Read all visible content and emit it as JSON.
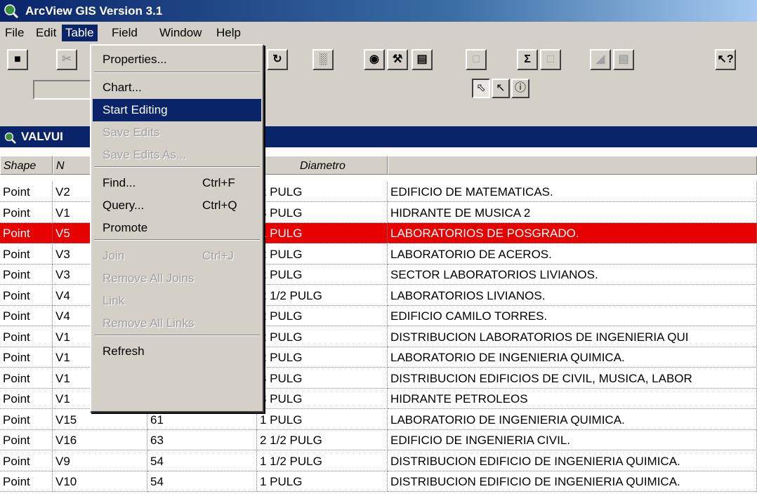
{
  "window": {
    "title": "ArcView GIS Version 3.1"
  },
  "menubar": {
    "items": [
      "File",
      "Edit",
      "Table",
      "Field",
      "Window",
      "Help"
    ]
  },
  "doc": {
    "title": "VALVUI"
  },
  "table": {
    "columns": [
      "Shape",
      "N",
      "",
      "Diametro",
      ""
    ],
    "rows": [
      [
        "Point",
        "V2",
        "",
        "2 PULG",
        "EDIFICIO DE MATEMATICAS."
      ],
      [
        "Point",
        "V1",
        "",
        "3 PULG",
        "HIDRANTE DE MUSICA 2"
      ],
      [
        "Point",
        "V5",
        "",
        "1 PULG",
        "LABORATORIOS DE POSGRADO."
      ],
      [
        "Point",
        "V3",
        "",
        "2 PULG",
        "LABORATORIO DE ACEROS."
      ],
      [
        "Point",
        "V3",
        "",
        "2 PULG",
        "SECTOR LABORATORIOS LIVIANOS."
      ],
      [
        "Point",
        "V4",
        "",
        "2 1/2 PULG",
        "LABORATORIOS LIVIANOS."
      ],
      [
        "Point",
        "V4",
        "",
        "2 PULG",
        "EDIFICIO CAMILO TORRES."
      ],
      [
        "Point",
        "V1",
        "",
        "2 PULG",
        "DISTRIBUCION LABORATORIOS DE INGENIERIA QUI"
      ],
      [
        "Point",
        "V1",
        "",
        "2 PULG",
        "LABORATORIO DE INGENIERIA QUIMICA."
      ],
      [
        "Point",
        "V1",
        "",
        "3 PULG",
        "DISTRIBUCION EDIFICIOS DE CIVIL, MUSICA, LABOR"
      ],
      [
        "Point",
        "V1",
        "",
        "3 PULG",
        "HIDRANTE PETROLEOS"
      ],
      [
        "Point",
        "V15",
        "61",
        "1 PULG",
        "LABORATORIO DE INGENIERIA QUIMICA."
      ],
      [
        "Point",
        "V16",
        "63",
        "2 1/2 PULG",
        "EDIFICIO DE INGENIERIA CIVIL."
      ],
      [
        "Point",
        "V9",
        "54",
        "1 1/2 PULG",
        "DISTRIBUCION EDIFICIO DE INGENIERIA QUIMICA."
      ],
      [
        "Point",
        "V10",
        "54",
        "1 PULG",
        "DISTRIBUCION  EDIFICIO DE INGENIERIA QUIMICA."
      ]
    ],
    "selected_row_index": 2,
    "selected_color": "#e60000"
  },
  "table_menu": {
    "items": [
      {
        "label": "Properties...",
        "shortcut": "",
        "enabled": true
      },
      {
        "label": "Chart...",
        "shortcut": "",
        "enabled": true
      },
      {
        "label": "Start Editing",
        "shortcut": "",
        "enabled": true,
        "highlighted": true
      },
      {
        "label": "Save Edits",
        "shortcut": "",
        "enabled": false
      },
      {
        "label": "Save Edits As...",
        "shortcut": "",
        "enabled": false
      },
      {
        "label": "Find...",
        "shortcut": "Ctrl+F",
        "enabled": true
      },
      {
        "label": "Query...",
        "shortcut": "Ctrl+Q",
        "enabled": true
      },
      {
        "label": "Promote",
        "shortcut": "",
        "enabled": true
      },
      {
        "label": "Join",
        "shortcut": "Ctrl+J",
        "enabled": false
      },
      {
        "label": "Remove All Joins",
        "shortcut": "",
        "enabled": false
      },
      {
        "label": "Link",
        "shortcut": "",
        "enabled": false
      },
      {
        "label": "Remove All Links",
        "shortcut": "",
        "enabled": false
      },
      {
        "label": "Refresh",
        "shortcut": "",
        "enabled": true
      }
    ]
  },
  "toolbar": {
    "buttons": [
      "save-icon",
      "cut-icon",
      "refresh-icon",
      "statistics-icon",
      "find-icon",
      "query-builder-icon",
      "promote-icon",
      "join-icon",
      "summarize-icon",
      "calculate-icon",
      "sort-ascending-icon",
      "sort-descending-icon",
      "help-icon"
    ]
  }
}
